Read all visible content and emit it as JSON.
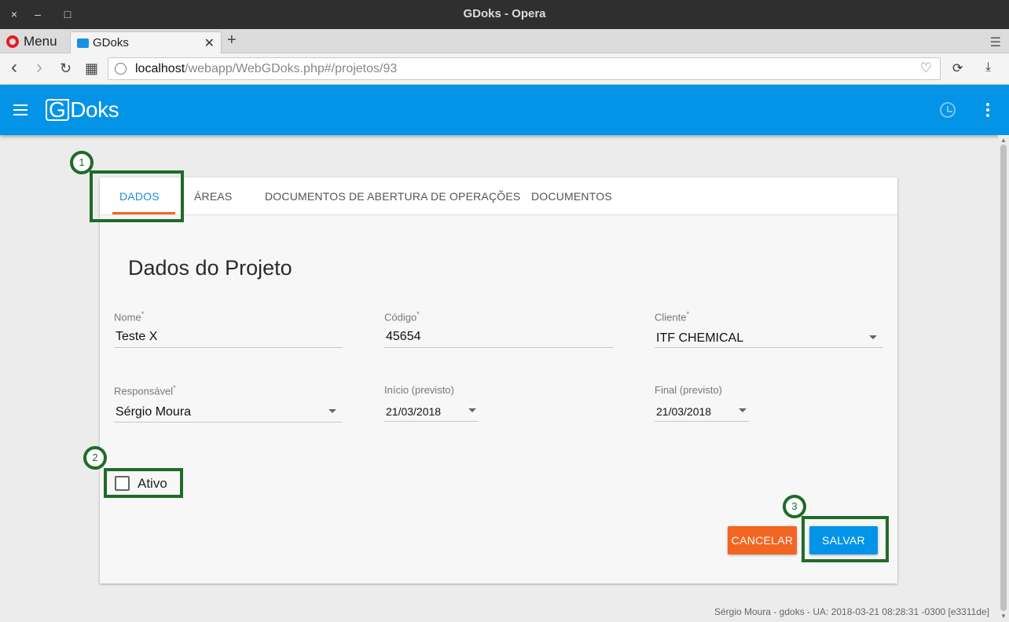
{
  "window": {
    "title": "GDoks - Opera",
    "close_glyph": "×",
    "minimize_glyph": "–",
    "maximize_glyph": "□"
  },
  "browser": {
    "menu_label": "Menu",
    "tab_title": "GDoks",
    "tab_close_glyph": "✕",
    "newtab_glyph": "+",
    "tabmenu_glyph": "☰",
    "url_host": "localhost",
    "url_path": "/webapp/WebGDoks.php#/projetos/93",
    "back_glyph": "‹",
    "forward_glyph": "›",
    "reload_glyph": "↻",
    "grid_glyph": "▦",
    "heart_glyph": "♡",
    "sync_glyph": "⟳",
    "download_glyph": "⤓"
  },
  "app": {
    "logo_g": "G",
    "logo_rest": "Doks",
    "accent_color": "#0394e8"
  },
  "tabs": [
    {
      "label": "DADOS"
    },
    {
      "label": "ÁREAS"
    },
    {
      "label": "DOCUMENTOS DE ABERTURA DE OPERAÇÕES"
    },
    {
      "label": "DOCUMENTOS"
    }
  ],
  "form": {
    "section_title": "Dados do Projeto",
    "nome": {
      "label": "Nome",
      "required": "*",
      "value": "Teste X"
    },
    "codigo": {
      "label": "Código",
      "required": "*",
      "value": "45654"
    },
    "cliente": {
      "label": "Cliente",
      "required": "*",
      "value": "ITF CHEMICAL"
    },
    "responsavel": {
      "label": "Responsável",
      "required": "*",
      "value": "Sérgio Moura"
    },
    "inicio": {
      "label": "Início (previsto)",
      "value": "21/03/2018"
    },
    "final": {
      "label": "Final (previsto)",
      "value": "21/03/2018"
    },
    "ativo": {
      "label": "Ativo",
      "checked": false
    }
  },
  "buttons": {
    "cancel": "CANCELAR",
    "save": "SALVAR"
  },
  "annotations": {
    "one": "1",
    "two": "2",
    "three": "3"
  },
  "footer": "Sérgio Moura - gdoks - UA: 2018-03-21 08:28:31 -0300 [e3311de]"
}
